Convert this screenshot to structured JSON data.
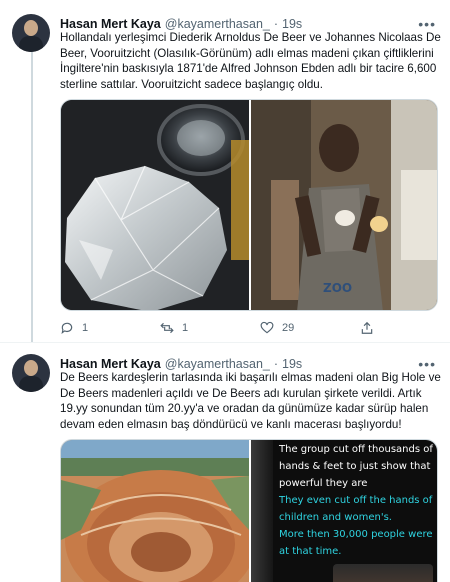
{
  "tweets": [
    {
      "author": {
        "name": "Hasan Mert Kaya",
        "handle": "@kayamerthasan_",
        "time": "19s"
      },
      "text": "Hollandalı yerleşimci Diederik Arnoldus De Beer ve Johannes Nicolaas De Beer, Vooruitzicht (Olasılık-Görünüm) adlı elmas madeni çıkan çiftliklerini İngiltere'nin baskısıyla 1871'de Alfred Johnson Ebden adlı bir tacire 6,600 sterline sattılar. Vooruitzicht sadece başlangıç oldu.",
      "actions": {
        "replies": "1",
        "retweets": "1",
        "likes": "29"
      }
    },
    {
      "author": {
        "name": "Hasan Mert Kaya",
        "handle": "@kayamerthasan_",
        "time": "19s"
      },
      "text": "De Beers kardeşlerin tarlasında iki başarılı elmas madeni olan Big Hole ve De Beers madenleri açıldı ve De Beers adı kurulan şirkete verildi. Artık 19.yy sonundan tüm 20.yy'a ve oradan da günümüze kadar sürüp halen devam eden elmasın baş döndürücü ve kanlı macerası başlıyordu!",
      "image_text": {
        "line1": "The group cut off thousands of",
        "line2": "hands & feet to just show that",
        "line3": "powerful they are",
        "line4": "They even cut off the hands of",
        "line5": "children and women's.",
        "line6": "More then 30,000 people were",
        "line7": "at that time."
      }
    }
  ],
  "colors": {
    "text_primary": "#0f1419",
    "text_secondary": "#536471",
    "divider": "#eff3f4",
    "quote_white": "#ffffff",
    "quote_cyan": "#2fd3e0"
  },
  "icons": [
    "reply-icon",
    "retweet-icon",
    "like-icon",
    "share-icon",
    "more-icon"
  ]
}
